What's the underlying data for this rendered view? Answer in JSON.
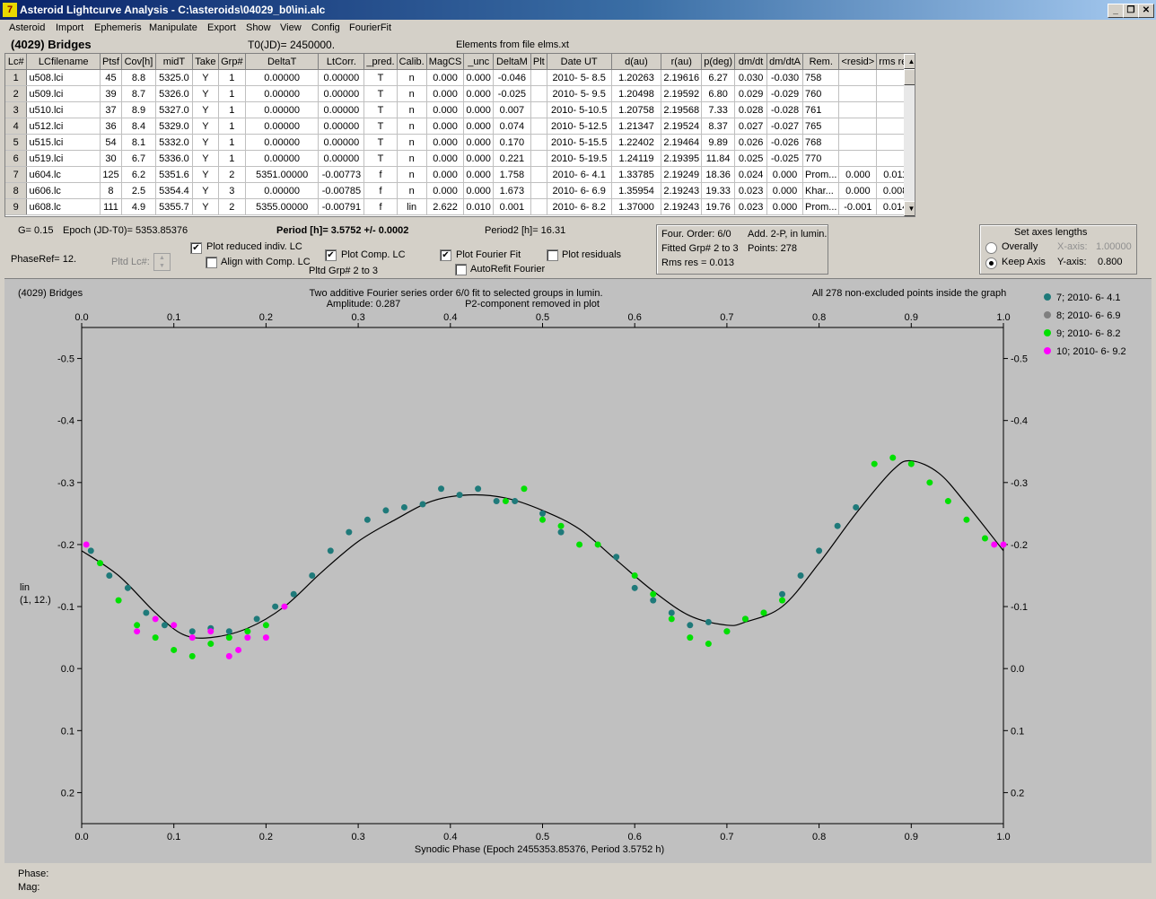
{
  "window": {
    "title": "Asteroid Lightcurve Analysis - C:\\asteroids\\04029_b0\\ini.alc",
    "icon": "app-logo-icon"
  },
  "menu": [
    "Asteroid",
    "Import",
    "Ephemeris",
    "Manipulate",
    "Export",
    "Show",
    "View",
    "Config",
    "FourierFit"
  ],
  "header": {
    "asteroid": "(4029) Bridges",
    "t0": "T0(JD)= 2450000.",
    "elements": "Elements from file elms.xt"
  },
  "table": {
    "columns": [
      "Lc#",
      "LCfilename",
      "Ptsf",
      "Cov[h]",
      "midT",
      "Take",
      "Grp#",
      "DeltaT",
      "LtCorr.",
      "_pred.",
      "Calib.",
      "MagCS",
      "_unc",
      "DeltaM",
      "Plt",
      "Date UT",
      "d(au)",
      "r(au)",
      "p(deg)",
      "dm/dt",
      "dm/dtA",
      "Rem.",
      "<resid>",
      "rms res"
    ],
    "rows": [
      [
        "1",
        "u508.lci",
        "45",
        "8.8",
        "5325.0",
        "Y",
        "1",
        "0.00000",
        "0.00000",
        "T",
        "n",
        "0.000",
        "0.000",
        "-0.046",
        "",
        "2010- 5- 8.5",
        "1.20263",
        "2.19616",
        "6.27",
        "0.030",
        "-0.030",
        "758",
        "",
        ""
      ],
      [
        "2",
        "u509.lci",
        "39",
        "8.7",
        "5326.0",
        "Y",
        "1",
        "0.00000",
        "0.00000",
        "T",
        "n",
        "0.000",
        "0.000",
        "-0.025",
        "",
        "2010- 5- 9.5",
        "1.20498",
        "2.19592",
        "6.80",
        "0.029",
        "-0.029",
        "760",
        "",
        ""
      ],
      [
        "3",
        "u510.lci",
        "37",
        "8.9",
        "5327.0",
        "Y",
        "1",
        "0.00000",
        "0.00000",
        "T",
        "n",
        "0.000",
        "0.000",
        "0.007",
        "",
        "2010- 5-10.5",
        "1.20758",
        "2.19568",
        "7.33",
        "0.028",
        "-0.028",
        "761",
        "",
        ""
      ],
      [
        "4",
        "u512.lci",
        "36",
        "8.4",
        "5329.0",
        "Y",
        "1",
        "0.00000",
        "0.00000",
        "T",
        "n",
        "0.000",
        "0.000",
        "0.074",
        "",
        "2010- 5-12.5",
        "1.21347",
        "2.19524",
        "8.37",
        "0.027",
        "-0.027",
        "765",
        "",
        ""
      ],
      [
        "5",
        "u515.lci",
        "54",
        "8.1",
        "5332.0",
        "Y",
        "1",
        "0.00000",
        "0.00000",
        "T",
        "n",
        "0.000",
        "0.000",
        "0.170",
        "",
        "2010- 5-15.5",
        "1.22402",
        "2.19464",
        "9.89",
        "0.026",
        "-0.026",
        "768",
        "",
        ""
      ],
      [
        "6",
        "u519.lci",
        "30",
        "6.7",
        "5336.0",
        "Y",
        "1",
        "0.00000",
        "0.00000",
        "T",
        "n",
        "0.000",
        "0.000",
        "0.221",
        "",
        "2010- 5-19.5",
        "1.24119",
        "2.19395",
        "11.84",
        "0.025",
        "-0.025",
        "770",
        "",
        ""
      ],
      [
        "7",
        "u604.lc",
        "125",
        "6.2",
        "5351.6",
        "Y",
        "2",
        "5351.00000",
        "-0.00773",
        "f",
        "n",
        "0.000",
        "0.000",
        "1.758",
        "",
        "2010- 6- 4.1",
        "1.33785",
        "2.19249",
        "18.36",
        "0.024",
        "0.000",
        "Prom...",
        "0.000",
        "0.011"
      ],
      [
        "8",
        "u606.lc",
        "8",
        "2.5",
        "5354.4",
        "Y",
        "3",
        "0.00000",
        "-0.00785",
        "f",
        "n",
        "0.000",
        "0.000",
        "1.673",
        "",
        "2010- 6- 6.9",
        "1.35954",
        "2.19243",
        "19.33",
        "0.023",
        "0.000",
        "Khar...",
        "0.000",
        "0.008"
      ],
      [
        "9",
        "u608.lc",
        "111",
        "4.9",
        "5355.7",
        "Y",
        "2",
        "5355.00000",
        "-0.00791",
        "f",
        "lin",
        "2.622",
        "0.010",
        "0.001",
        "",
        "2010- 6- 8.2",
        "1.37000",
        "2.19243",
        "19.76",
        "0.023",
        "0.000",
        "Prom...",
        "-0.001",
        "0.014"
      ]
    ]
  },
  "controls": {
    "g": "G= 0.15",
    "epoch": "Epoch (JD-T0)= 5353.85376",
    "period": "Period [h]= 3.5752 +/- 0.0002",
    "period2": "Period2 [h]= 16.31",
    "phaseref": "PhaseRef= 12.",
    "pltd_lc": "Pltd Lc#:",
    "plot_reduced": "Plot reduced indiv. LC",
    "align_comp": "Align with Comp. LC",
    "plot_comp": "Plot Comp. LC",
    "pltd_grp": "Pltd Grp#  2   to   3",
    "plot_fourier": "Plot Fourier Fit",
    "autorefit": "AutoRefit Fourier",
    "plot_residuals": "Plot residuals"
  },
  "fourier_info": {
    "order": "Four. Order:  6/0",
    "add": "Add. 2-P, in lumin.",
    "fitted": "Fitted Grp# 2 to 3",
    "points": "Points: 278",
    "rms": "Rms res      = 0.013"
  },
  "axes_panel": {
    "title": "Set axes lengths",
    "overall": "Overally",
    "keep": "Keep Axis",
    "xaxis_label": "X-axis:",
    "xaxis_value": "1.00000",
    "yaxis_label": "Y-axis:",
    "yaxis_value": "0.800"
  },
  "status": {
    "phase": "Phase:",
    "mag": "Mag:"
  },
  "chart_data": {
    "type": "scatter",
    "title": "(4029) Bridges",
    "subtitle": "Two additive Fourier series order 6/0 fit to selected groups in lumin.",
    "amplitude": "Amplitude: 0.287",
    "p2note": "P2-component removed in plot",
    "points_note": "All 278 non-excluded points inside the graph",
    "xlabel": "Synodic Phase (Epoch 2455353.85376, Period 3.5752 h)",
    "ylabel": "lin",
    "ylabel2": "(1, 12.)",
    "xlim": [
      0,
      1
    ],
    "ylim": [
      -0.55,
      0.25
    ],
    "y_inverted": true,
    "xticks": [
      0.0,
      0.1,
      0.2,
      0.3,
      0.4,
      0.5,
      0.6,
      0.7,
      0.8,
      0.9,
      1.0
    ],
    "xtick_labels": [
      "0.0",
      "0.1",
      "0.2",
      "0.3",
      "0.4",
      "0.5",
      "0.6",
      "0.7",
      "0.8",
      "0.9",
      "1.0"
    ],
    "yticks": [
      -0.5,
      -0.4,
      -0.3,
      -0.2,
      -0.1,
      0.0,
      0.1,
      0.2
    ],
    "ytick_labels": [
      "-0.5",
      "-0.4",
      "-0.3",
      "-0.2",
      "-0.1",
      "0.0",
      "0.1",
      "0.2"
    ],
    "fit_curve": [
      [
        0.0,
        -0.19
      ],
      [
        0.04,
        -0.15
      ],
      [
        0.08,
        -0.09
      ],
      [
        0.11,
        -0.055
      ],
      [
        0.14,
        -0.05
      ],
      [
        0.18,
        -0.065
      ],
      [
        0.22,
        -0.1
      ],
      [
        0.26,
        -0.155
      ],
      [
        0.3,
        -0.205
      ],
      [
        0.34,
        -0.24
      ],
      [
        0.38,
        -0.27
      ],
      [
        0.42,
        -0.28
      ],
      [
        0.46,
        -0.275
      ],
      [
        0.5,
        -0.255
      ],
      [
        0.54,
        -0.225
      ],
      [
        0.58,
        -0.175
      ],
      [
        0.62,
        -0.125
      ],
      [
        0.66,
        -0.085
      ],
      [
        0.7,
        -0.07
      ],
      [
        0.72,
        -0.075
      ],
      [
        0.76,
        -0.1
      ],
      [
        0.8,
        -0.17
      ],
      [
        0.84,
        -0.25
      ],
      [
        0.88,
        -0.32
      ],
      [
        0.9,
        -0.335
      ],
      [
        0.93,
        -0.315
      ],
      [
        0.96,
        -0.265
      ],
      [
        1.0,
        -0.19
      ]
    ],
    "series": [
      {
        "name": "7; 2010- 6- 4.1",
        "color": "#1f7a7a",
        "x": [
          0.01,
          0.03,
          0.05,
          0.07,
          0.09,
          0.12,
          0.14,
          0.16,
          0.19,
          0.21,
          0.23,
          0.25,
          0.27,
          0.29,
          0.31,
          0.33,
          0.35,
          0.37,
          0.39,
          0.41,
          0.43,
          0.45,
          0.47,
          0.5,
          0.52,
          0.58,
          0.6,
          0.62,
          0.64,
          0.66,
          0.68,
          0.7,
          0.72,
          0.74,
          0.76,
          0.78,
          0.8,
          0.82,
          0.84
        ],
        "y": [
          -0.19,
          -0.15,
          -0.13,
          -0.09,
          -0.07,
          -0.06,
          -0.065,
          -0.06,
          -0.08,
          -0.1,
          -0.12,
          -0.15,
          -0.19,
          -0.22,
          -0.24,
          -0.255,
          -0.26,
          -0.265,
          -0.29,
          -0.28,
          -0.29,
          -0.27,
          -0.27,
          -0.25,
          -0.22,
          -0.18,
          -0.13,
          -0.11,
          -0.09,
          -0.07,
          -0.075,
          -0.06,
          -0.08,
          -0.09,
          -0.12,
          -0.15,
          -0.19,
          -0.23,
          -0.26
        ]
      },
      {
        "name": "8; 2010- 6- 6.9",
        "color": "#7f7f7f",
        "x": [],
        "y": []
      },
      {
        "name": "9; 2010- 6- 8.2",
        "color": "#00e000",
        "x": [
          0.02,
          0.04,
          0.06,
          0.08,
          0.1,
          0.12,
          0.14,
          0.16,
          0.18,
          0.2,
          0.46,
          0.48,
          0.5,
          0.52,
          0.54,
          0.56,
          0.6,
          0.62,
          0.64,
          0.66,
          0.68,
          0.7,
          0.72,
          0.74,
          0.76,
          0.86,
          0.88,
          0.9,
          0.92,
          0.94,
          0.96,
          0.98
        ],
        "y": [
          -0.17,
          -0.11,
          -0.07,
          -0.05,
          -0.03,
          -0.02,
          -0.04,
          -0.05,
          -0.06,
          -0.07,
          -0.27,
          -0.29,
          -0.24,
          -0.23,
          -0.2,
          -0.2,
          -0.15,
          -0.12,
          -0.08,
          -0.05,
          -0.04,
          -0.06,
          -0.08,
          -0.09,
          -0.11,
          -0.33,
          -0.34,
          -0.33,
          -0.3,
          -0.27,
          -0.24,
          -0.21
        ]
      },
      {
        "name": "10; 2010- 6- 9.2",
        "color": "#ff00ff",
        "x": [
          0.005,
          0.06,
          0.08,
          0.1,
          0.12,
          0.14,
          0.16,
          0.17,
          0.18,
          0.2,
          0.22,
          0.99,
          1.0
        ],
        "y": [
          -0.2,
          -0.06,
          -0.08,
          -0.07,
          -0.05,
          -0.06,
          -0.02,
          -0.03,
          -0.05,
          -0.05,
          -0.1,
          -0.2,
          -0.2
        ]
      }
    ]
  }
}
